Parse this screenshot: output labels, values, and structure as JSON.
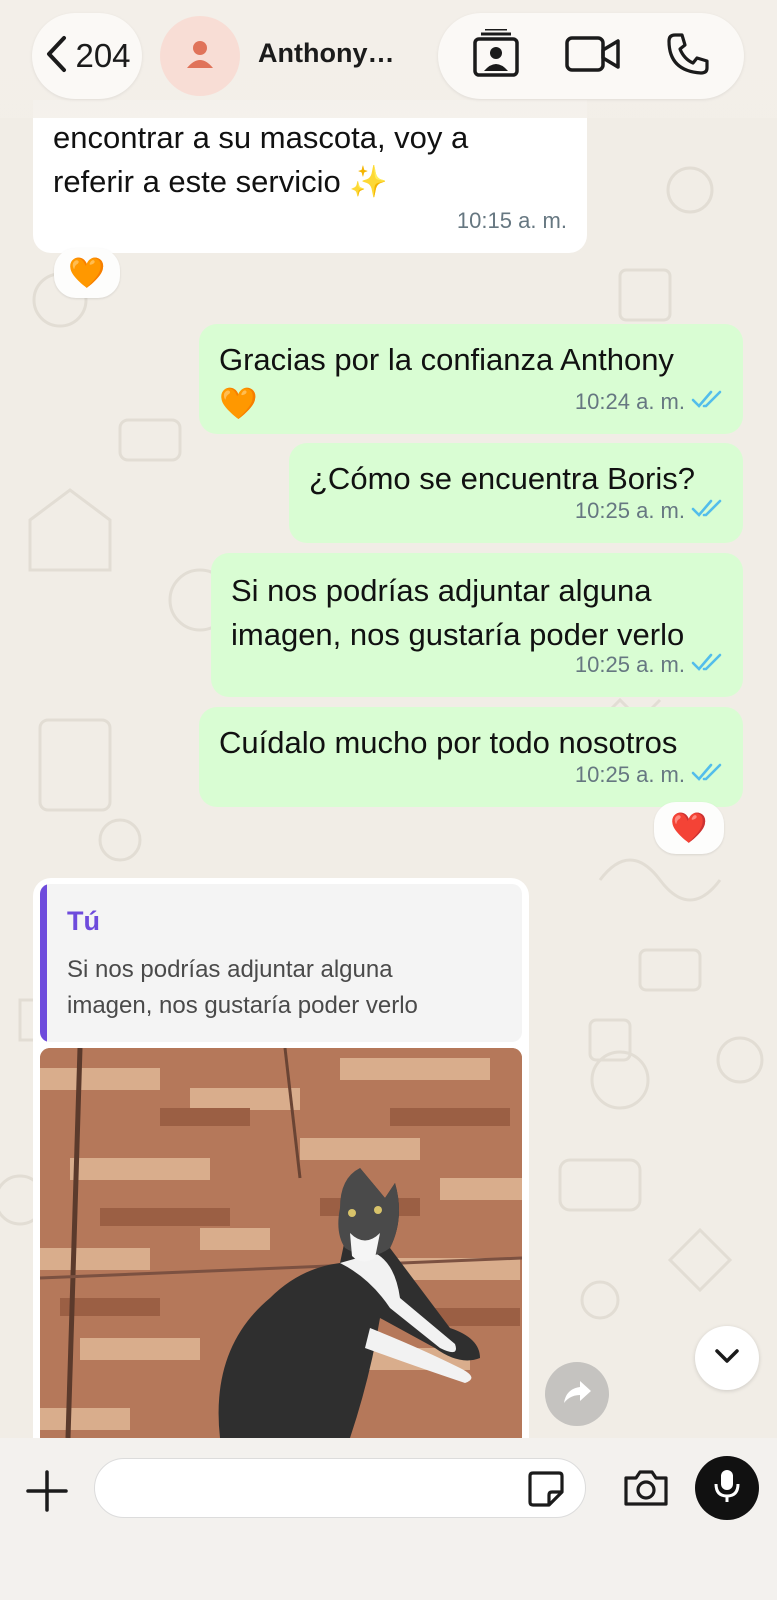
{
  "header": {
    "back_count": "204",
    "contact_name": "Anthony…"
  },
  "messages": [
    {
      "lines": [
        "encontrar a su mascota, voy a",
        "referir a este servicio ✨"
      ],
      "time": "10:15 a. m.",
      "reaction": "🧡"
    },
    {
      "lines": [
        "Gracias por la confianza Anthony",
        "🧡"
      ],
      "time": "10:24 a. m."
    },
    {
      "lines": [
        "¿Cómo se encuentra Boris?"
      ],
      "time": "10:25 a. m."
    },
    {
      "lines": [
        "Si nos podrías adjuntar alguna",
        "imagen, nos gustaría poder verlo"
      ],
      "time": "10:25 a. m."
    },
    {
      "lines": [
        "Cuídalo mucho por todo nosotros"
      ],
      "time": "10:25 a. m.",
      "reaction": "❤️"
    }
  ],
  "reply": {
    "quote_author": "Tú",
    "quote_lines": [
      "Si nos podrías adjuntar alguna",
      "imagen, nos gustaría poder verlo"
    ]
  },
  "input": {
    "placeholder": ""
  },
  "colors": {
    "outgoing_bubble": "#d9fdd3",
    "incoming_bubble": "#ffffff",
    "read_tick": "#53bdeb",
    "quote_accent": "#6e4bdc"
  },
  "icons": [
    "chevron-left-icon",
    "person-icon",
    "contact-card-icon",
    "video-camera-icon",
    "phone-icon",
    "double-check-icon",
    "forward-icon",
    "chevron-down-icon",
    "plus-icon",
    "sticker-icon",
    "camera-icon",
    "microphone-icon"
  ]
}
